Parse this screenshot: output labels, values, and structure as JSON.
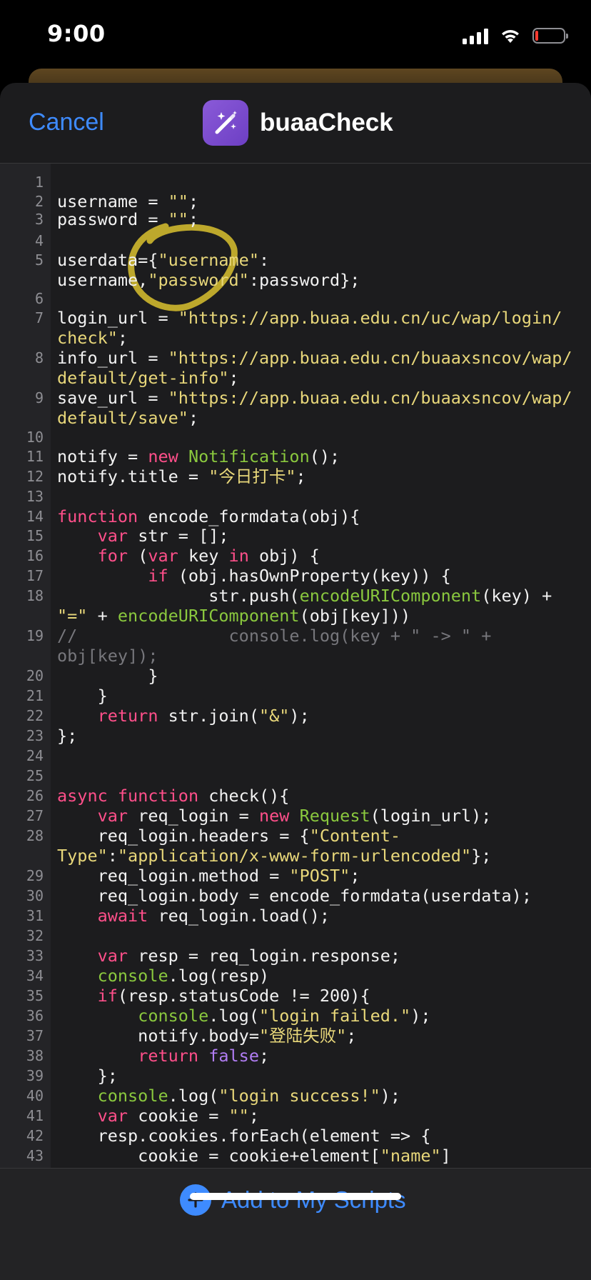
{
  "status_bar": {
    "time": "9:00",
    "battery_level": 0.1
  },
  "header": {
    "cancel_label": "Cancel",
    "title": "buaaCheck",
    "app_icon": "magic-wand-icon",
    "accent_color": "#3e8bff"
  },
  "code": {
    "lines": [
      {
        "n": "1",
        "tokens": []
      },
      {
        "n": "2",
        "tokens": [
          {
            "t": "username = "
          },
          {
            "t": "\"\"",
            "c": "s"
          },
          {
            "t": ";"
          }
        ]
      },
      {
        "n": "3",
        "tokens": [
          {
            "t": "password = "
          },
          {
            "t": "\"\"",
            "c": "s"
          },
          {
            "t": ";"
          }
        ]
      },
      {
        "n": "4",
        "tokens": []
      },
      {
        "n": "5",
        "tokens": [
          {
            "t": "userdata={"
          },
          {
            "t": "\"username\"",
            "c": "s"
          },
          {
            "t": ":"
          }
        ]
      },
      {
        "n": "",
        "tokens": [
          {
            "t": "username,"
          },
          {
            "t": "\"password\"",
            "c": "s"
          },
          {
            "t": ":password};"
          }
        ]
      },
      {
        "n": "6",
        "tokens": []
      },
      {
        "n": "7",
        "tokens": [
          {
            "t": "login_url = "
          },
          {
            "t": "\"https://app.buaa.edu.cn/uc/wap/login/",
            "c": "s"
          }
        ]
      },
      {
        "n": "",
        "tokens": [
          {
            "t": "check\"",
            "c": "s"
          },
          {
            "t": ";"
          }
        ]
      },
      {
        "n": "8",
        "tokens": [
          {
            "t": "info_url = "
          },
          {
            "t": "\"https://app.buaa.edu.cn/buaaxsncov/wap/",
            "c": "s"
          }
        ]
      },
      {
        "n": "",
        "tokens": [
          {
            "t": "default/get-info\"",
            "c": "s"
          },
          {
            "t": ";"
          }
        ]
      },
      {
        "n": "9",
        "tokens": [
          {
            "t": "save_url = "
          },
          {
            "t": "\"https://app.buaa.edu.cn/buaaxsncov/wap/",
            "c": "s"
          }
        ]
      },
      {
        "n": "",
        "tokens": [
          {
            "t": "default/save\"",
            "c": "s"
          },
          {
            "t": ";"
          }
        ]
      },
      {
        "n": "10",
        "tokens": []
      },
      {
        "n": "11",
        "tokens": [
          {
            "t": "notify = "
          },
          {
            "t": "new",
            "c": "k"
          },
          {
            "t": " "
          },
          {
            "t": "Notification",
            "c": "c"
          },
          {
            "t": "();"
          }
        ]
      },
      {
        "n": "12",
        "tokens": [
          {
            "t": "notify.title = "
          },
          {
            "t": "\"今日打卡\"",
            "c": "s"
          },
          {
            "t": ";"
          }
        ]
      },
      {
        "n": "13",
        "tokens": []
      },
      {
        "n": "14",
        "tokens": [
          {
            "t": "function",
            "c": "k"
          },
          {
            "t": " encode_formdata(obj){"
          }
        ]
      },
      {
        "n": "15",
        "tokens": [
          {
            "t": "    "
          },
          {
            "t": "var",
            "c": "k"
          },
          {
            "t": " str = [];"
          }
        ]
      },
      {
        "n": "16",
        "tokens": [
          {
            "t": "    "
          },
          {
            "t": "for",
            "c": "k"
          },
          {
            "t": " ("
          },
          {
            "t": "var",
            "c": "k"
          },
          {
            "t": " key "
          },
          {
            "t": "in",
            "c": "k"
          },
          {
            "t": " obj) {"
          }
        ]
      },
      {
        "n": "17",
        "tokens": [
          {
            "t": "         "
          },
          {
            "t": "if",
            "c": "k"
          },
          {
            "t": " (obj.hasOwnProperty(key)) {"
          }
        ]
      },
      {
        "n": "18",
        "tokens": [
          {
            "t": "               str.push("
          },
          {
            "t": "encodeURIComponent",
            "c": "c"
          },
          {
            "t": "(key) +"
          }
        ]
      },
      {
        "n": "",
        "tokens": [
          {
            "t": "\"=\"",
            "c": "s"
          },
          {
            "t": " + "
          },
          {
            "t": "encodeURIComponent",
            "c": "c"
          },
          {
            "t": "(obj[key]))"
          }
        ]
      },
      {
        "n": "19",
        "tokens": [
          {
            "t": "//               console.log(key + \" -> \" +",
            "c": "cm"
          }
        ]
      },
      {
        "n": "",
        "tokens": [
          {
            "t": "obj[key]);",
            "c": "cm"
          }
        ]
      },
      {
        "n": "20",
        "tokens": [
          {
            "t": "         }"
          }
        ]
      },
      {
        "n": "21",
        "tokens": [
          {
            "t": "    }"
          }
        ]
      },
      {
        "n": "22",
        "tokens": [
          {
            "t": "    "
          },
          {
            "t": "return",
            "c": "k"
          },
          {
            "t": " str.join("
          },
          {
            "t": "\"&\"",
            "c": "s"
          },
          {
            "t": ");"
          }
        ]
      },
      {
        "n": "23",
        "tokens": [
          {
            "t": "};"
          }
        ]
      },
      {
        "n": "24",
        "tokens": []
      },
      {
        "n": "25",
        "tokens": []
      },
      {
        "n": "26",
        "tokens": [
          {
            "t": "async",
            "c": "k"
          },
          {
            "t": " "
          },
          {
            "t": "function",
            "c": "k"
          },
          {
            "t": " check(){"
          }
        ]
      },
      {
        "n": "27",
        "tokens": [
          {
            "t": "    "
          },
          {
            "t": "var",
            "c": "k"
          },
          {
            "t": " req_login = "
          },
          {
            "t": "new",
            "c": "k"
          },
          {
            "t": " "
          },
          {
            "t": "Request",
            "c": "c"
          },
          {
            "t": "(login_url);"
          }
        ]
      },
      {
        "n": "28",
        "tokens": [
          {
            "t": "    req_login.headers = {"
          },
          {
            "t": "\"Content-",
            "c": "s"
          }
        ]
      },
      {
        "n": "",
        "tokens": [
          {
            "t": "Type\"",
            "c": "s"
          },
          {
            "t": ":"
          },
          {
            "t": "\"application/x-www-form-urlencoded\"",
            "c": "s"
          },
          {
            "t": "};"
          }
        ]
      },
      {
        "n": "29",
        "tokens": [
          {
            "t": "    req_login.method = "
          },
          {
            "t": "\"POST\"",
            "c": "s"
          },
          {
            "t": ";"
          }
        ]
      },
      {
        "n": "30",
        "tokens": [
          {
            "t": "    req_login.body = encode_formdata(userdata);"
          }
        ]
      },
      {
        "n": "31",
        "tokens": [
          {
            "t": "    "
          },
          {
            "t": "await",
            "c": "k"
          },
          {
            "t": " req_login.load();"
          }
        ]
      },
      {
        "n": "32",
        "tokens": []
      },
      {
        "n": "33",
        "tokens": [
          {
            "t": "    "
          },
          {
            "t": "var",
            "c": "k"
          },
          {
            "t": " resp = req_login.response;"
          }
        ]
      },
      {
        "n": "34",
        "tokens": [
          {
            "t": "    "
          },
          {
            "t": "console",
            "c": "c"
          },
          {
            "t": ".log(resp)"
          }
        ]
      },
      {
        "n": "35",
        "tokens": [
          {
            "t": "    "
          },
          {
            "t": "if",
            "c": "k"
          },
          {
            "t": "(resp.statusCode != 200){"
          }
        ]
      },
      {
        "n": "36",
        "tokens": [
          {
            "t": "        "
          },
          {
            "t": "console",
            "c": "c"
          },
          {
            "t": ".log("
          },
          {
            "t": "\"login failed.\"",
            "c": "s"
          },
          {
            "t": ");"
          }
        ]
      },
      {
        "n": "37",
        "tokens": [
          {
            "t": "        notify.body="
          },
          {
            "t": "\"登陆失败\"",
            "c": "s"
          },
          {
            "t": ";"
          }
        ]
      },
      {
        "n": "38",
        "tokens": [
          {
            "t": "        "
          },
          {
            "t": "return",
            "c": "k"
          },
          {
            "t": " "
          },
          {
            "t": "false",
            "c": "b"
          },
          {
            "t": ";"
          }
        ]
      },
      {
        "n": "39",
        "tokens": [
          {
            "t": "    };"
          }
        ]
      },
      {
        "n": "40",
        "tokens": [
          {
            "t": "    "
          },
          {
            "t": "console",
            "c": "c"
          },
          {
            "t": ".log("
          },
          {
            "t": "\"login success!\"",
            "c": "s"
          },
          {
            "t": ");"
          }
        ]
      },
      {
        "n": "41",
        "tokens": [
          {
            "t": "    "
          },
          {
            "t": "var",
            "c": "k"
          },
          {
            "t": " cookie = "
          },
          {
            "t": "\"\"",
            "c": "s"
          },
          {
            "t": ";"
          }
        ]
      },
      {
        "n": "42",
        "tokens": [
          {
            "t": "    resp.cookies.forEach(element => {"
          }
        ]
      },
      {
        "n": "43",
        "tokens": [
          {
            "t": "        cookie = cookie+element["
          },
          {
            "t": "\"name\"",
            "c": "s"
          },
          {
            "t": "]"
          }
        ]
      }
    ]
  },
  "footer": {
    "add_label": "Add to My Scripts",
    "add_icon": "plus-circle-icon"
  }
}
